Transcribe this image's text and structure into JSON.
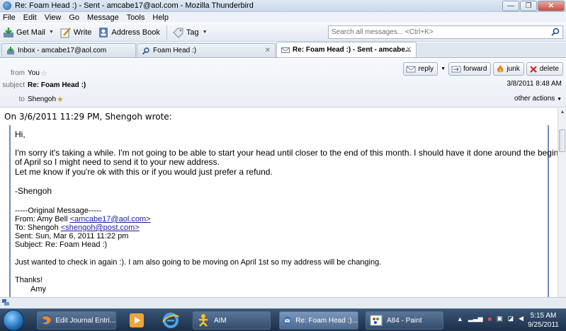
{
  "window": {
    "title": "Re: Foam Head :) - Sent - amcabe17@aol.com - Mozilla Thunderbird",
    "buttons": {
      "minimize": "—",
      "maximize": "❐",
      "close": "✕"
    }
  },
  "menu": [
    "File",
    "Edit",
    "View",
    "Go",
    "Message",
    "Tools",
    "Help"
  ],
  "toolbar": {
    "get_mail": "Get Mail",
    "write": "Write",
    "address_book": "Address Book",
    "tag": "Tag",
    "search_placeholder": "Search all messages... <Ctrl+K>"
  },
  "tabs": [
    {
      "label": "Inbox - amcabe17@aol.com"
    },
    {
      "label": "Foam Head :)"
    },
    {
      "label": "Re: Foam Head :) - Sent - amcabe..."
    }
  ],
  "header": {
    "from_label": "from",
    "from_value": "You",
    "subject_label": "subject",
    "subject_value": "Re: Foam Head :)",
    "to_label": "to",
    "to_value": "Shengoh",
    "date": "3/8/2011 8:48 AM",
    "other_actions": "other actions",
    "buttons": {
      "reply": "reply",
      "forward": "forward",
      "junk": "junk",
      "delete": "delete"
    }
  },
  "body": {
    "wrote_line": "On 3/6/2011 11:29 PM, Shengoh wrote:",
    "greeting": "Hi,",
    "para1_line1": "I'm sorry it's taking a while. I'm not going to be able to start your head until closer to the end of this month. I should have it done around the beginning",
    "para1_line2": "of April so I might need to send it to your new address.",
    "para1_line3": "Let me know if you're ok with this or if you would just prefer a refund.",
    "signature": "-Shengoh",
    "original_header": "-----Original Message-----",
    "from_prefix": "From: Amy Bell ",
    "from_email": "<amcabe17@aol.com>",
    "to_prefix": "To: Shengoh ",
    "to_email": "<shengoh@post.com>",
    "sent": "Sent: Sun, Mar 6, 2011 11:22 pm",
    "subject": "Subject: Re: Foam Head :)",
    "orig_text": "Just wanted to check in again :). I am also going to be moving on April 1st so my address will be changing.",
    "thanks": "Thanks!",
    "name": "Amy"
  },
  "taskbar": {
    "tasks": [
      {
        "label": "Edit Journal Entri..."
      },
      {
        "label": "AIM"
      },
      {
        "label": "Re: Foam Head :)..."
      },
      {
        "label": "A84 - Paint"
      }
    ],
    "clock_time": "5:15 AM",
    "clock_date": "9/25/2011"
  }
}
